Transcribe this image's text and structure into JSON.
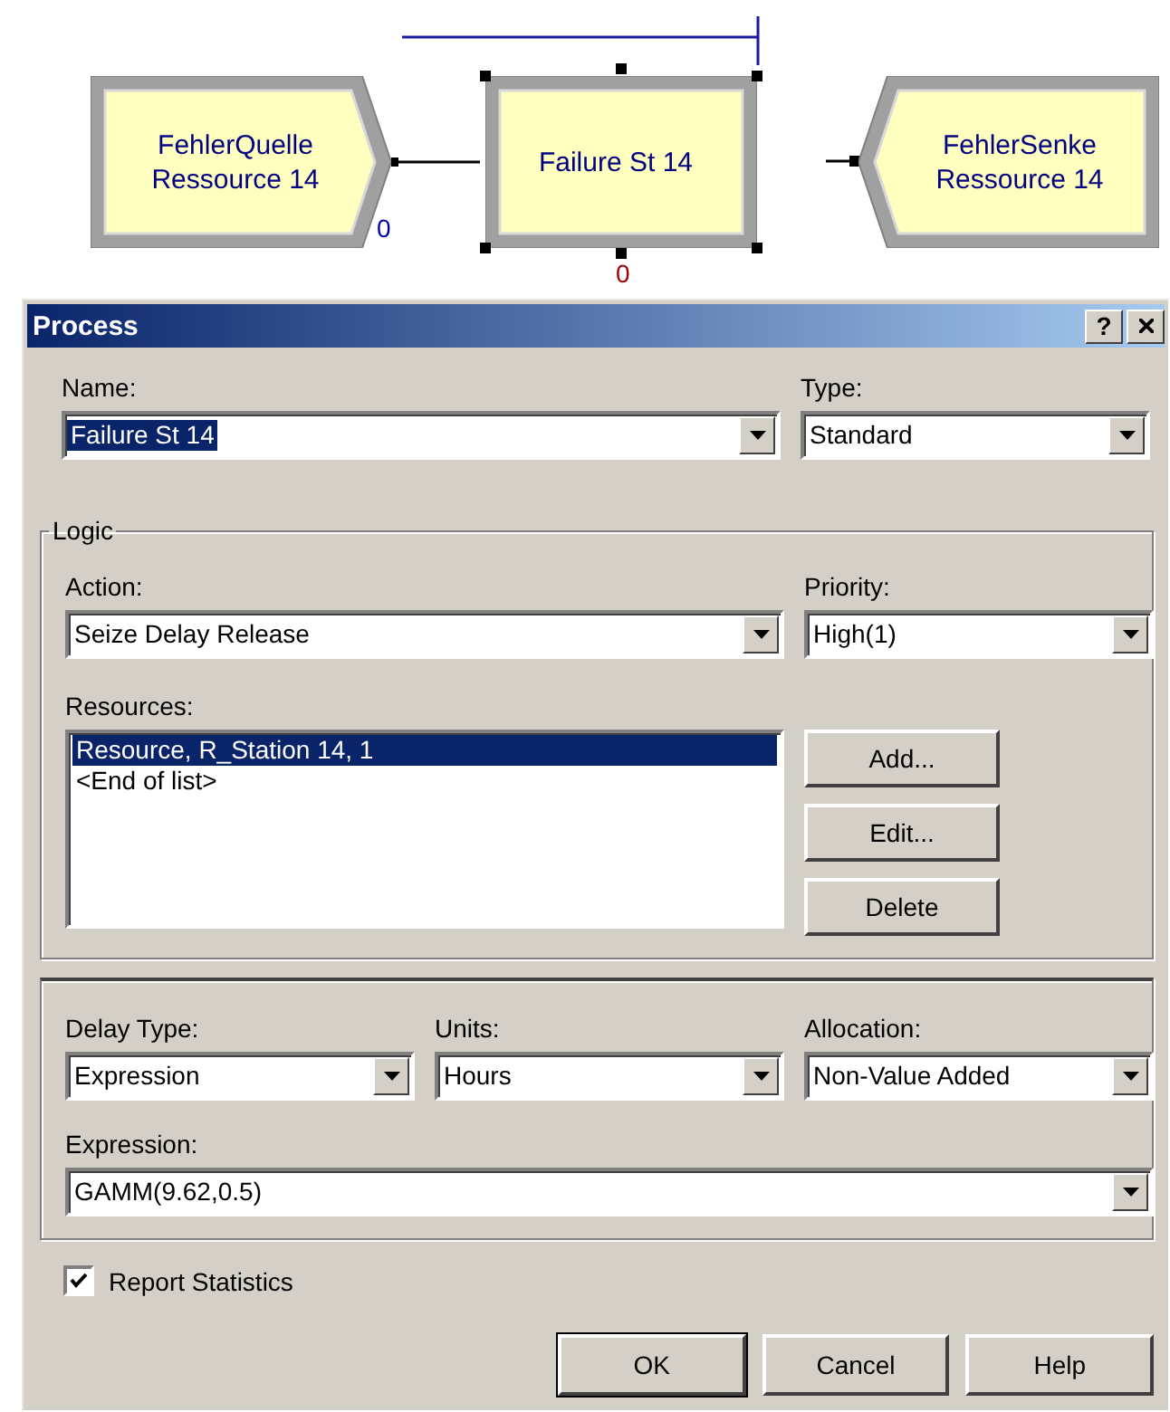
{
  "canvas": {
    "modules": [
      {
        "kind": "create",
        "lines": [
          "FehlerQuelle",
          "Ressource 14"
        ],
        "count": "0",
        "color": "#0000a0",
        "selected": false
      },
      {
        "kind": "process",
        "lines": [
          "Failure St 14"
        ],
        "count": "0",
        "color": "#a00000",
        "selected": true
      },
      {
        "kind": "dispose",
        "lines": [
          "FehlerSenke",
          "Ressource 14"
        ],
        "selected": false
      }
    ]
  },
  "dialog": {
    "title": "Process",
    "help_button": "?",
    "name": {
      "label": "Name:",
      "value": "Failure St 14",
      "highlighted": true
    },
    "type": {
      "label": "Type:",
      "value": "Standard"
    },
    "logic": {
      "legend": "Logic",
      "action": {
        "label": "Action:",
        "value": "Seize Delay Release"
      },
      "priority": {
        "label": "Priority:",
        "value": "High(1)"
      },
      "resources": {
        "label": "Resources:",
        "items": [
          {
            "text": "Resource, R_Station 14, 1",
            "selected": true
          },
          {
            "text": "<End of list>",
            "selected": false
          }
        ]
      },
      "buttons": [
        "Add...",
        "Edit...",
        "Delete"
      ]
    },
    "delay_type": {
      "label": "Delay Type:",
      "value": "Expression"
    },
    "units": {
      "label": "Units:",
      "value": "Hours"
    },
    "allocation": {
      "label": "Allocation:",
      "value": "Non-Value Added"
    },
    "expression": {
      "label": "Expression:",
      "value": "GAMM(9.62,0.5)"
    },
    "report_statistics": {
      "label": "Report Statistics",
      "checked": true
    },
    "buttons": [
      {
        "label": "OK",
        "default": true
      },
      {
        "label": "Cancel",
        "default": false
      },
      {
        "label": "Help",
        "default": false
      }
    ]
  }
}
